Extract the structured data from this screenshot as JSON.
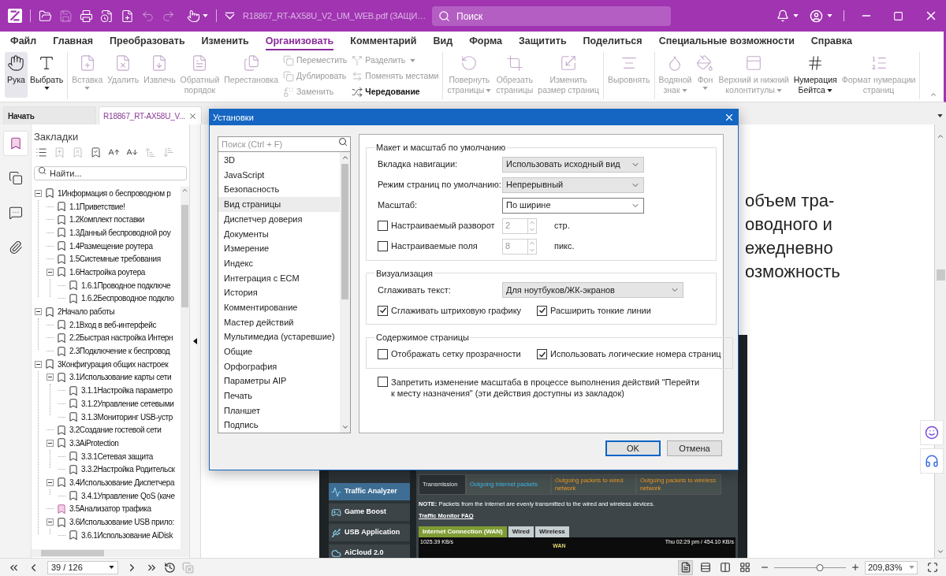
{
  "title_bar": {
    "quick_tools": [
      {
        "disabled": false
      },
      {
        "disabled": true
      },
      {
        "disabled": false
      },
      {
        "disabled": false
      },
      {
        "disabled": false
      },
      {
        "disabled": true
      },
      {
        "disabled": true
      }
    ],
    "file_title": "R18867_RT-AX58U_V2_UM_WEB.pdf (ЗАЩИ…",
    "search": {
      "placeholder": "Поиск"
    }
  },
  "menu": [
    {
      "label": "Файл",
      "selected": false
    },
    {
      "label": "Главная",
      "selected": false
    },
    {
      "label": "Преобразовать",
      "selected": false
    },
    {
      "label": "Изменить",
      "selected": false
    },
    {
      "label": "Организовать",
      "selected": true
    },
    {
      "label": "Комментарий",
      "selected": false
    },
    {
      "label": "Вид",
      "selected": false
    },
    {
      "label": "Форма",
      "selected": false
    },
    {
      "label": "Защитить",
      "selected": false
    },
    {
      "label": "Поделиться",
      "selected": false
    },
    {
      "label": "Специальные возможности",
      "selected": false
    },
    {
      "label": "Справка",
      "selected": false
    }
  ],
  "ribbon": {
    "groups": [
      {
        "items": [
          {
            "kind": "large",
            "lines": [
              "Рука"
            ],
            "selected": true,
            "disabled": false,
            "dropdown": false
          },
          {
            "kind": "large",
            "lines": [
              "Выбрать"
            ],
            "selected": false,
            "disabled": false,
            "dropdown": true
          }
        ]
      },
      {
        "items": [
          {
            "kind": "large",
            "lines": [
              "Вставка"
            ],
            "selected": false,
            "disabled": true,
            "dropdown": true
          },
          {
            "kind": "large",
            "lines": [
              "Удалить"
            ],
            "selected": false,
            "disabled": true,
            "dropdown": false
          },
          {
            "kind": "large",
            "lines": [
              "Извлечь"
            ],
            "selected": false,
            "disabled": true,
            "dropdown": false
          },
          {
            "kind": "large",
            "lines": [
              "Обратный",
              "порядок"
            ],
            "selected": false,
            "disabled": true,
            "dropdown": false
          },
          {
            "kind": "large",
            "lines": [
              "Перестановка"
            ],
            "selected": false,
            "disabled": true,
            "dropdown": false
          },
          {
            "kind": "stack",
            "items": [
              {
                "label": "Переместить",
                "disabled": true,
                "dropdown": false
              },
              {
                "label": "Дублировать",
                "disabled": true,
                "dropdown": false
              },
              {
                "label": "Заменить",
                "disabled": true,
                "dropdown": false
              }
            ]
          },
          {
            "kind": "stack",
            "items": [
              {
                "label": "Разделить",
                "disabled": true,
                "dropdown": true
              },
              {
                "label": "Поменять местами",
                "disabled": true,
                "dropdown": false
              },
              {
                "label": "Чередование",
                "disabled": false,
                "dropdown": false
              }
            ]
          }
        ]
      },
      {
        "items": [
          {
            "kind": "large",
            "lines": [
              "Повернуть",
              "страницы"
            ],
            "selected": false,
            "disabled": true,
            "dropdown": true
          },
          {
            "kind": "large",
            "lines": [
              "Обрезать",
              "страницы"
            ],
            "selected": false,
            "disabled": true,
            "dropdown": false
          },
          {
            "kind": "large",
            "lines": [
              "Изменить",
              "размер страниц"
            ],
            "selected": false,
            "disabled": true,
            "dropdown": false
          }
        ]
      },
      {
        "items": [
          {
            "kind": "large",
            "lines": [
              "Выровнять"
            ],
            "selected": false,
            "disabled": true,
            "dropdown": false
          }
        ]
      },
      {
        "items": [
          {
            "kind": "large",
            "lines": [
              "Водяной",
              "знак"
            ],
            "selected": false,
            "disabled": true,
            "dropdown": true
          },
          {
            "kind": "large",
            "lines": [
              "Фон"
            ],
            "selected": false,
            "disabled": true,
            "dropdown": true
          },
          {
            "kind": "large",
            "lines": [
              "Верхний и нижний",
              "колонтитулы"
            ],
            "selected": false,
            "disabled": true,
            "dropdown": true
          },
          {
            "kind": "large",
            "lines": [
              "Нумерация",
              "Бейтса"
            ],
            "selected": false,
            "disabled": false,
            "dropdown": true
          },
          {
            "kind": "large",
            "lines": [
              "Формат нумерации",
              "страниц"
            ],
            "selected": false,
            "disabled": true,
            "dropdown": false
          }
        ]
      }
    ]
  },
  "tabs": [
    {
      "label": "Начать",
      "selected": false,
      "closable": false
    },
    {
      "label": "R18867_RT-AX58U_V...",
      "selected": true,
      "closable": true
    }
  ],
  "side_rail": [
    {
      "selected": true
    },
    {
      "selected": false
    },
    {
      "selected": false
    },
    {
      "selected": false
    }
  ],
  "bookmarks": {
    "title": "Закладки",
    "tools": [
      {
        "disabled": false
      },
      {
        "disabled": true
      },
      {
        "disabled": true
      },
      {
        "disabled": false
      },
      {
        "disabled": false
      },
      {
        "disabled": false
      },
      {
        "disabled": true
      },
      {
        "disabled": true
      }
    ],
    "search": {
      "placeholder": "Найти..."
    },
    "tree": [
      {
        "label": "1Информация о беспроводном р",
        "selected": false,
        "expanded": true,
        "children": [
          {
            "label": "1.1Приветствие!",
            "selected": false
          },
          {
            "label": "1.2Комплект поставки",
            "selected": false
          },
          {
            "label": "1.3Данный беспроводной роу",
            "selected": false
          },
          {
            "label": "1.4Размещение роутера",
            "selected": false
          },
          {
            "label": "1.5Системные требования",
            "selected": false
          },
          {
            "label": "1.6Настройка роутера",
            "selected": false,
            "expanded": true,
            "children": [
              {
                "label": "1.6.1Проводное подключе",
                "selected": false
              },
              {
                "label": "1.6.2Беспроводное подклю",
                "selected": false
              }
            ]
          }
        ]
      },
      {
        "label": "2Начало работы",
        "selected": false,
        "expanded": true,
        "children": [
          {
            "label": "2.1Вход в веб-интерфейс",
            "selected": false
          },
          {
            "label": "2.2Быстрая настройка Интерн",
            "selected": false
          },
          {
            "label": "2.3Подключение к беспровод",
            "selected": false
          }
        ]
      },
      {
        "label": "3Конфигурация общих настроек",
        "selected": false,
        "expanded": true,
        "children": [
          {
            "label": "3.1Использование карты сети",
            "selected": false,
            "expanded": true,
            "children": [
              {
                "label": "3.1.1Настройка параметро",
                "selected": false
              },
              {
                "label": "3.1.2Управление сетевыми",
                "selected": false
              },
              {
                "label": "3.1.3Мониторинг USB-устр",
                "selected": false
              }
            ]
          },
          {
            "label": "3.2Создание гостевой сети",
            "selected": false
          },
          {
            "label": "3.3AiProtection",
            "selected": false,
            "expanded": true,
            "children": [
              {
                "label": "3.3.1Сетевая защита",
                "selected": false
              },
              {
                "label": "3.3.2Настройка Родительск",
                "selected": false
              }
            ]
          },
          {
            "label": "3.4Использование Диспетчера",
            "selected": false,
            "expanded": true,
            "children": [
              {
                "label": "3.4.1Управление QoS (каче",
                "selected": false
              }
            ]
          },
          {
            "label": "3.5Анализатор трафика",
            "selected": true
          },
          {
            "label": "3.6Использование USB прило:",
            "selected": false,
            "expanded": true,
            "children": [
              {
                "label": "3.6.1Использование AiDisk",
                "selected": false
              }
            ]
          }
        ]
      }
    ]
  },
  "document": {
    "text_lines": [
      "объем тра-",
      "оводного и",
      "ежедневно",
      "озможность"
    ],
    "embedded_screenshot": {
      "nav_items": [
        {
          "label": "Traffic Analyzer",
          "selected": true
        },
        {
          "label": "Game Boost",
          "selected": false
        },
        {
          "label": "USB Application",
          "selected": false
        },
        {
          "label": "AiCloud 2.0",
          "selected": false
        }
      ],
      "table_row": [
        "Transmission",
        "Outgoing Internet packets",
        "Outgoing packets to wired network",
        "Outgoing packets to wireless network"
      ],
      "note": "**NOTE:** Packets from the Internet are evenly transmitted to the wired and wireless devices.",
      "link": "Traffic Monitor FAQ",
      "tabs": [
        {
          "label": "Internet Connection (WAN)",
          "selected": true
        },
        {
          "label": "Wired",
          "selected": false
        },
        {
          "label": "Wireless",
          "selected": false
        }
      ],
      "graph": {
        "left": "1025.39 KB/s",
        "center": "WAN",
        "right": "Thu 02:29 pm / 454.10 KB/s"
      }
    }
  },
  "dialog": {
    "title": "Установки",
    "search": {
      "placeholder": "Поиск (Ctrl + F)"
    },
    "categories": [
      {
        "label": "3D",
        "selected": false
      },
      {
        "label": "JavaScript",
        "selected": false
      },
      {
        "label": "Безопасность",
        "selected": false
      },
      {
        "label": "Вид страницы",
        "selected": true
      },
      {
        "label": "Диспетчер доверия",
        "selected": false
      },
      {
        "label": "Документы",
        "selected": false
      },
      {
        "label": "Измерение",
        "selected": false
      },
      {
        "label": "Индекс",
        "selected": false
      },
      {
        "label": "Интеграция с ECM",
        "selected": false
      },
      {
        "label": "История",
        "selected": false
      },
      {
        "label": "Комментирование",
        "selected": false
      },
      {
        "label": "Мастер действий",
        "selected": false
      },
      {
        "label": "Мультимедиа (устаревшие)",
        "selected": false
      },
      {
        "label": "Общие",
        "selected": false
      },
      {
        "label": "Орфография",
        "selected": false
      },
      {
        "label": "Параметры AIP",
        "selected": false
      },
      {
        "label": "Печать",
        "selected": false
      },
      {
        "label": "Планшет",
        "selected": false
      },
      {
        "label": "Подпись",
        "selected": false
      }
    ],
    "groups": [
      {
        "title": "Макет и масштаб по умолчанию",
        "rows": [
          {
            "kind": "select",
            "label": "Вкладка навигации:",
            "value": "Использовать исходный вид",
            "editable": false
          },
          {
            "kind": "select",
            "label": "Режим страниц по умолчанию:",
            "value": "Непрерывный",
            "editable": false
          },
          {
            "kind": "select",
            "label": "Масштаб:",
            "value": "По ширине",
            "editable": true
          },
          {
            "kind": "spin",
            "label": "Настраиваемый разворот",
            "checked": false,
            "value": "2",
            "unit": "стр."
          },
          {
            "kind": "spin",
            "label": "Настраиваемые поля",
            "checked": false,
            "value": "8",
            "unit": "пикс."
          }
        ]
      },
      {
        "title": "Визуализация",
        "rows": [
          {
            "kind": "wide_select",
            "label": "Сглаживать текст:",
            "value": "Для ноутбуков/ЖК-экранов",
            "editable": false
          },
          {
            "kind": "checks",
            "items": [
              {
                "label": "Сглаживать штриховую графику",
                "checked": true
              },
              {
                "label": "Расширить тонкие линии",
                "checked": true
              }
            ]
          }
        ]
      },
      {
        "title": "Содержимое страницы",
        "rows": [
          {
            "kind": "checks",
            "items": [
              {
                "label": "Отображать сетку прозрачности",
                "checked": false
              },
              {
                "label": "Использовать логические номера страниц",
                "checked": true
              }
            ]
          }
        ]
      }
    ],
    "extra_option": {
      "label": "Запретить изменение масштаба в процессе выполнения действий \"Перейти к месту назначения\" (эти действия доступны из закладок)",
      "checked": false
    },
    "buttons": [
      {
        "label": "OK",
        "default": true
      },
      {
        "label": "Отмена",
        "default": false
      }
    ]
  },
  "status_bar": {
    "nav": [
      {
        "disabled": false
      },
      {
        "disabled": false
      },
      {
        "disabled": false
      },
      {
        "disabled": false
      }
    ],
    "page": "39 / 126",
    "history": [
      {
        "disabled": false
      },
      {
        "disabled": true
      }
    ],
    "view_modes": [
      {
        "selected": true
      },
      {
        "selected": false
      },
      {
        "selected": false
      },
      {
        "selected": false
      }
    ],
    "zoom": {
      "level": 0.64,
      "value": "209,83%"
    }
  }
}
